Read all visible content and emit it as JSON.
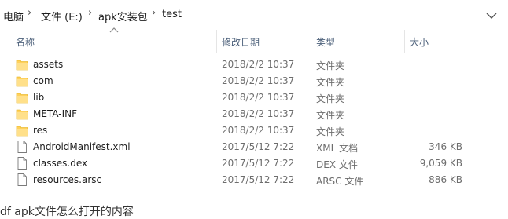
{
  "address": {
    "crumbs": [
      "电脑",
      "文件 (E:)",
      "apk安装包",
      "test"
    ]
  },
  "columns": {
    "name": "名称",
    "date": "修改日期",
    "type": "类型",
    "size": "大小"
  },
  "files": [
    {
      "name": "assets",
      "date": "2018/2/2 10:37",
      "type": "文件夹",
      "size": "",
      "icon": "folder-icon"
    },
    {
      "name": "com",
      "date": "2018/2/2 10:37",
      "type": "文件夹",
      "size": "",
      "icon": "folder-icon"
    },
    {
      "name": "lib",
      "date": "2018/2/2 10:37",
      "type": "文件夹",
      "size": "",
      "icon": "folder-icon"
    },
    {
      "name": "META-INF",
      "date": "2018/2/2 10:37",
      "type": "文件夹",
      "size": "",
      "icon": "folder-icon"
    },
    {
      "name": "res",
      "date": "2018/2/2 10:37",
      "type": "文件夹",
      "size": "",
      "icon": "folder-icon"
    },
    {
      "name": "AndroidManifest.xml",
      "date": "2017/5/12 7:22",
      "type": "XML 文档",
      "size": "346 KB",
      "icon": "file-icon"
    },
    {
      "name": "classes.dex",
      "date": "2017/5/12 7:22",
      "type": "DEX 文件",
      "size": "9,059 KB",
      "icon": "file-icon"
    },
    {
      "name": "resources.arsc",
      "date": "2017/5/12 7:22",
      "type": "ARSC 文件",
      "size": "886 KB",
      "icon": "file-icon"
    }
  ],
  "bottom_text": "df apk文件怎么打开的内容",
  "colors": {
    "folder": "#ffd15c",
    "header_text": "#4c607a",
    "secondary_text": "#6d6d6d"
  }
}
